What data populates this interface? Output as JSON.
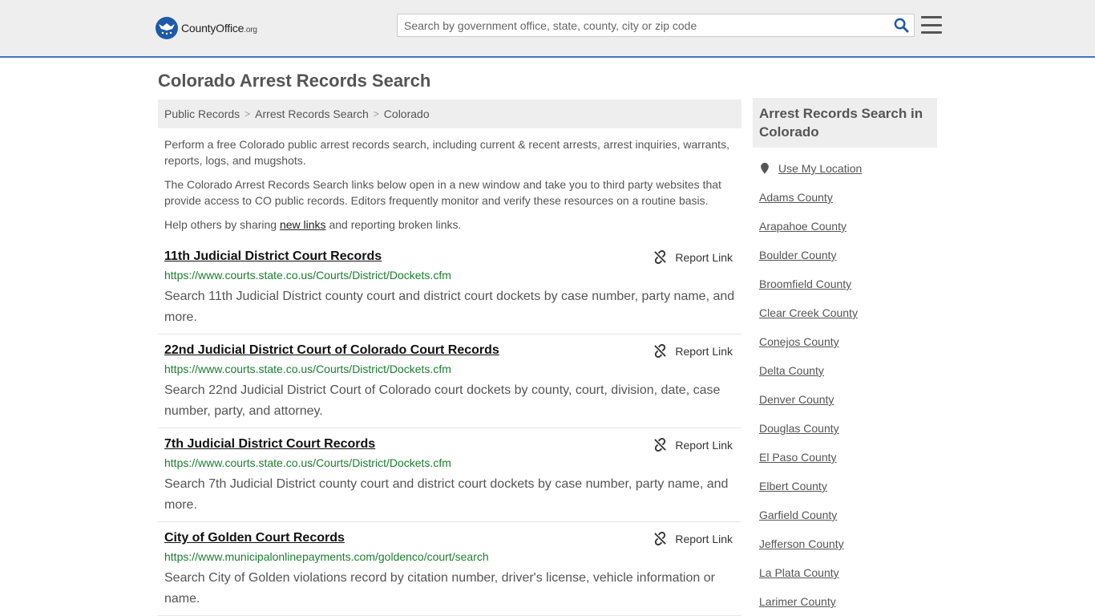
{
  "header": {
    "logo_main": "CountyOffice",
    "logo_tld": ".org",
    "search_placeholder": "Search by government office, state, county, city or zip code"
  },
  "page": {
    "title": "Colorado Arrest Records Search"
  },
  "breadcrumb": [
    "Public Records",
    "Arrest Records Search",
    "Colorado"
  ],
  "intro": {
    "p1": "Perform a free Colorado public arrest records search, including current & recent arrests, arrest inquiries, warrants, reports, logs, and mugshots.",
    "p2": "The Colorado Arrest Records Search links below open in a new window and take you to third party websites that provide access to CO public records. Editors frequently monitor and verify these resources on a routine basis.",
    "p3_before": "Help others by sharing ",
    "p3_link": "new links",
    "p3_after": " and reporting broken links."
  },
  "report_label": "Report Link",
  "results": [
    {
      "title": "11th Judicial District Court Records",
      "url": "https://www.courts.state.co.us/Courts/District/Dockets.cfm",
      "desc": "Search 11th Judicial District county court and district court dockets by case number, party name, and more."
    },
    {
      "title": "22nd Judicial District Court of Colorado Court Records",
      "url": "https://www.courts.state.co.us/Courts/District/Dockets.cfm",
      "desc": "Search 22nd Judicial District Court of Colorado court dockets by county, court, division, date, case number, party, and attorney."
    },
    {
      "title": "7th Judicial District Court Records",
      "url": "https://www.courts.state.co.us/Courts/District/Dockets.cfm",
      "desc": "Search 7th Judicial District county court and district court dockets by case number, party name, and more."
    },
    {
      "title": "City of Golden Court Records",
      "url": "https://www.municipalonlinepayments.com/goldenco/court/search",
      "desc": "Search City of Golden violations record by citation number, driver's license, vehicle information or name."
    }
  ],
  "sidebar": {
    "heading": "Arrest Records Search in Colorado",
    "use_location": "Use My Location",
    "counties": [
      "Adams County",
      "Arapahoe County",
      "Boulder County",
      "Broomfield County",
      "Clear Creek County",
      "Conejos County",
      "Delta County",
      "Denver County",
      "Douglas County",
      "El Paso County",
      "Elbert County",
      "Garfield County",
      "Jefferson County",
      "La Plata County",
      "Larimer County"
    ]
  },
  "colors": {
    "header_bg": "#eeeeee",
    "header_border": "#3d78ba",
    "logo_blue": "#1e5aa8",
    "url_green": "#1a7f2e",
    "search_icon": "#1e5aa8"
  },
  "icons": {
    "logo": "eagle-seal-icon",
    "search": "magnifier-icon",
    "menu": "hamburger-icon",
    "report": "broken-link-icon",
    "location": "map-pin-icon"
  }
}
